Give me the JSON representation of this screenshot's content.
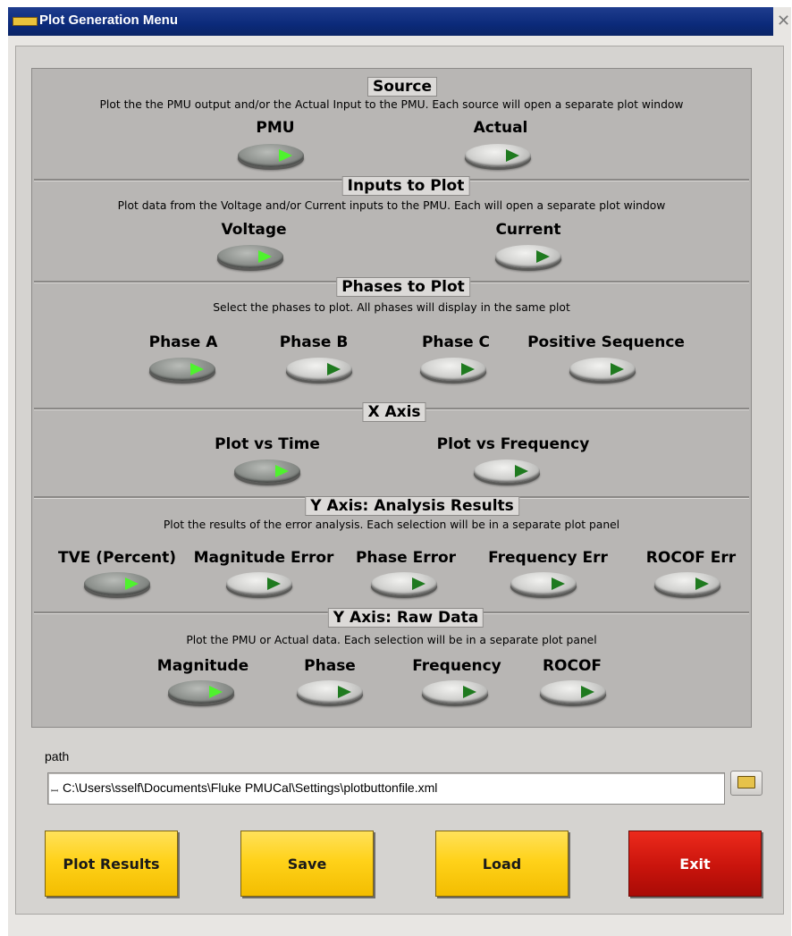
{
  "window": {
    "title": "Plot Generation Menu",
    "close_glyph": "✕"
  },
  "sections": {
    "source": {
      "title": "Source",
      "description": "Plot the the PMU output and/or the Actual Input to the PMU.  Each source will open a separate plot window",
      "toggles": [
        {
          "label": "PMU",
          "on": true
        },
        {
          "label": "Actual",
          "on": false
        }
      ]
    },
    "inputs": {
      "title": "Inputs to Plot",
      "description": "Plot data from the Voltage and/or Current inputs to the PMU. Each will open a separate plot window",
      "toggles": [
        {
          "label": "Voltage",
          "on": true
        },
        {
          "label": "Current",
          "on": false
        }
      ]
    },
    "phases": {
      "title": "Phases to Plot",
      "description": "Select the phases to plot.  All phases will display in the same plot",
      "toggles": [
        {
          "label": "Phase A",
          "on": true
        },
        {
          "label": "Phase B",
          "on": false
        },
        {
          "label": "Phase C",
          "on": false
        },
        {
          "label": "Positive Sequence",
          "on": false
        }
      ]
    },
    "x_axis": {
      "title": "X Axis",
      "toggles": [
        {
          "label": "Plot vs Time",
          "on": true
        },
        {
          "label": "Plot vs Frequency",
          "on": false
        }
      ]
    },
    "y_analysis": {
      "title": "Y Axis: Analysis Results",
      "description": "Plot the results of the error analysis. Each selection will be in a separate plot panel",
      "toggles": [
        {
          "label": "TVE (Percent)",
          "on": true
        },
        {
          "label": "Magnitude Error",
          "on": false
        },
        {
          "label": "Phase Error",
          "on": false
        },
        {
          "label": "Frequency Err",
          "on": false
        },
        {
          "label": "ROCOF Err",
          "on": false
        }
      ]
    },
    "y_raw": {
      "title": "Y Axis: Raw Data",
      "description": "Plot the PMU or Actual data. Each selection will be in a separate plot panel",
      "toggles": [
        {
          "label": "Magnitude",
          "on": true
        },
        {
          "label": "Phase",
          "on": false
        },
        {
          "label": "Frequency",
          "on": false
        },
        {
          "label": "ROCOF",
          "on": false
        }
      ]
    }
  },
  "path": {
    "label": "path",
    "value": "C:\\Users\\sself\\Documents\\Fluke PMUCal\\Settings\\plotbuttonfile.xml"
  },
  "buttons": {
    "plot_results": "Plot Results",
    "save": "Save",
    "load": "Load",
    "exit": "Exit"
  },
  "colors": {
    "led_on": "#4ff22e",
    "led_off": "#1f7a1f",
    "button_yellow": "#ffd21a",
    "button_red": "#c9140c",
    "titlebar": "#0b2a7a"
  },
  "icons": {
    "title": "app-icon",
    "browse": "folder-icon",
    "path_prefix": "path-symbol-icon"
  }
}
